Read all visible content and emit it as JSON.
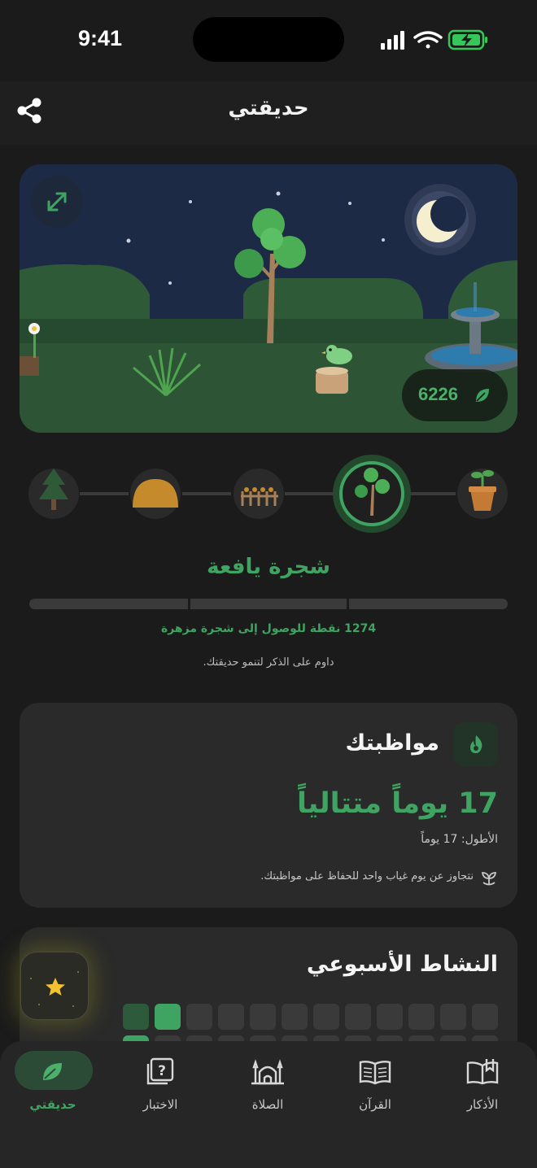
{
  "status": {
    "time": "9:41"
  },
  "header": {
    "title": "حديقتي"
  },
  "garden": {
    "points": "6226"
  },
  "stages": [
    "pine-tree",
    "dome",
    "fence",
    "young-tree",
    "sprout-pot"
  ],
  "current_stage": {
    "label": "شجرة يافعة",
    "points_left": "1274 نقطة للوصول إلى شجرة مزهرة",
    "hint": "داوم على الذكر لتنمو حديقتك."
  },
  "streak": {
    "title": "مواظبتك",
    "value": "17 يوماً متتالياً",
    "longest": "الأطول: 17 يوماً",
    "note": "نتجاوز عن يوم غياب واحد للحفاظ على مواظبتك."
  },
  "weekly": {
    "title": "النشاط الأسبوعي"
  },
  "tabs": [
    {
      "label": "حديقتي",
      "icon": "leaf-icon"
    },
    {
      "label": "الاختبار",
      "icon": "quiz-icon"
    },
    {
      "label": "الصلاة",
      "icon": "mosque-icon"
    },
    {
      "label": "القرآن",
      "icon": "quran-icon"
    },
    {
      "label": "الأذكار",
      "icon": "book-icon"
    }
  ],
  "colors": {
    "accent": "#3fa462",
    "background": "#1b1b1b",
    "card": "#2a2a2a"
  }
}
